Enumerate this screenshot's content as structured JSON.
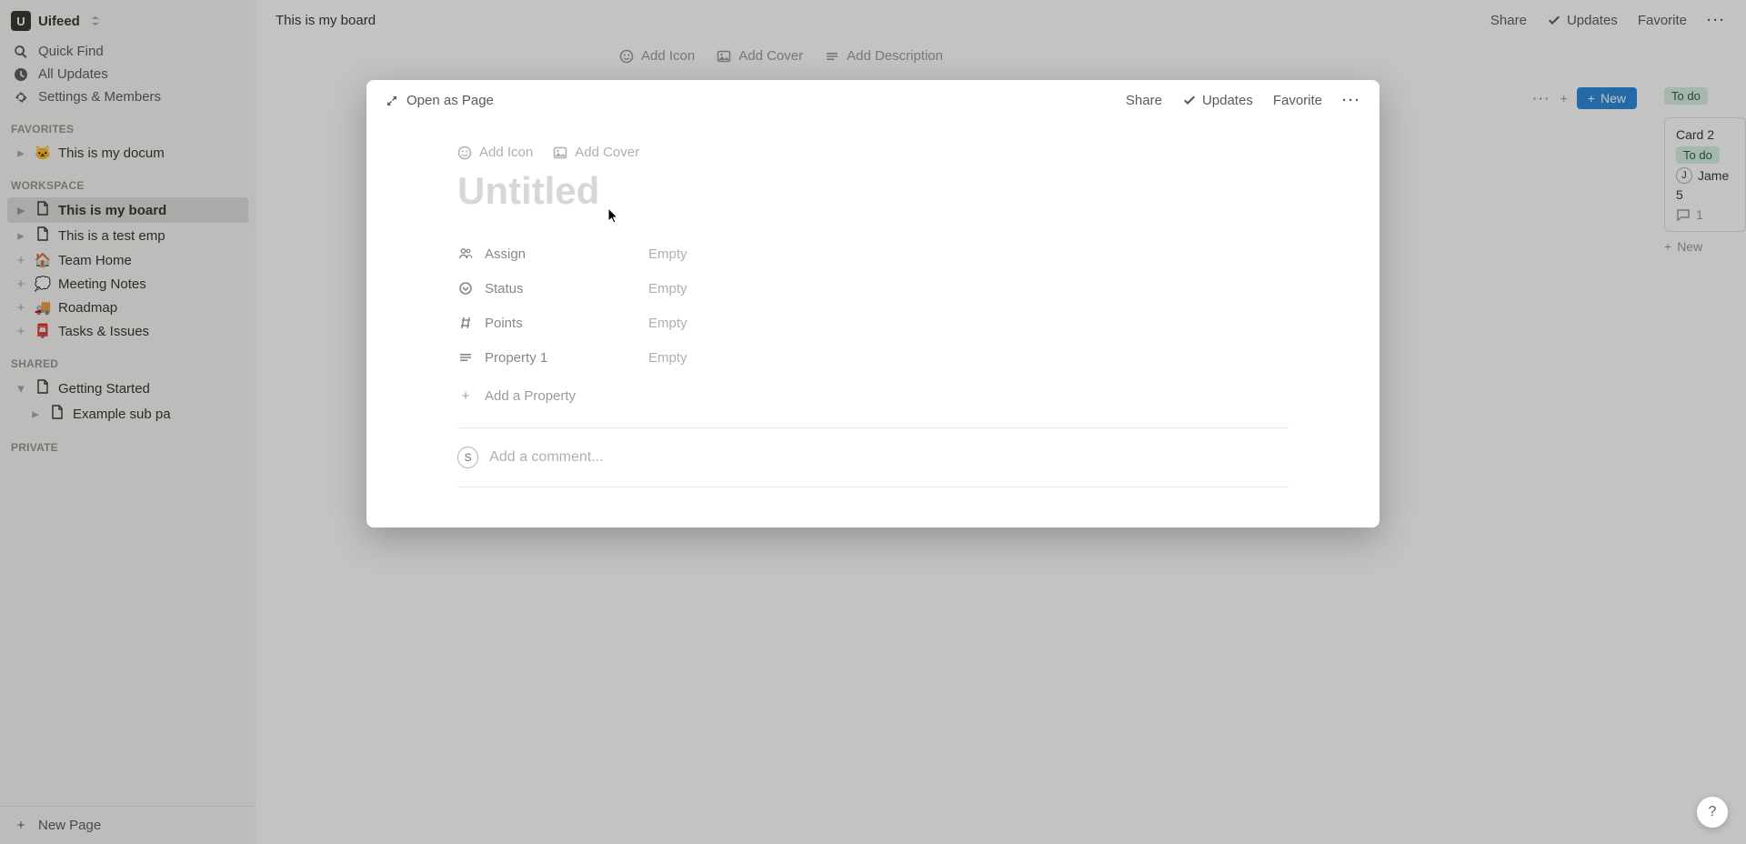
{
  "workspace": {
    "initial": "U",
    "name": "Uifeed"
  },
  "nav": {
    "quick_find": "Quick Find",
    "all_updates": "All Updates",
    "settings": "Settings & Members"
  },
  "sections": {
    "favorites": "FAVORITES",
    "workspace": "WORKSPACE",
    "shared": "SHARED",
    "private": "PRIVATE"
  },
  "favorites": [
    {
      "emoji": "🐱",
      "label": "This is my docum"
    }
  ],
  "workspace_pages": [
    {
      "icon": "page",
      "label": "This is my board",
      "active": true,
      "expander": "▸"
    },
    {
      "icon": "page",
      "label": "This is a test emp",
      "expander": "▸"
    },
    {
      "emoji": "🏠",
      "label": "Team Home",
      "expander": "+"
    },
    {
      "emoji": "💭",
      "label": "Meeting Notes",
      "expander": "+"
    },
    {
      "emoji": "🚚",
      "label": "Roadmap",
      "expander": "+"
    },
    {
      "emoji": "📮",
      "label": "Tasks & Issues",
      "expander": "+"
    }
  ],
  "shared_pages": [
    {
      "icon": "page",
      "label": "Getting Started",
      "expander": "▾"
    },
    {
      "icon": "page",
      "label": "Example sub pa",
      "sub": true,
      "expander": "▸"
    }
  ],
  "new_page": "New Page",
  "topbar": {
    "breadcrumb": "This is my board",
    "share": "Share",
    "updates": "Updates",
    "favorite": "Favorite"
  },
  "page_toolbar": {
    "add_icon": "Add Icon",
    "add_cover": "Add Cover",
    "add_desc": "Add Description"
  },
  "board": {
    "new_btn": "New",
    "col2_status": "To do",
    "card2": {
      "title": "Card 2",
      "status": "To do",
      "assignee_initial": "J",
      "assignee": "Jame",
      "points": "5",
      "comments": "1"
    },
    "new_card": "New"
  },
  "modal": {
    "open_as_page": "Open as Page",
    "share": "Share",
    "updates": "Updates",
    "favorite": "Favorite",
    "add_icon": "Add Icon",
    "add_cover": "Add Cover",
    "title_placeholder": "Untitled",
    "properties": [
      {
        "icon": "person",
        "name": "Assign",
        "value": "Empty"
      },
      {
        "icon": "tag",
        "name": "Status",
        "value": "Empty"
      },
      {
        "icon": "hash",
        "name": "Points",
        "value": "Empty"
      },
      {
        "icon": "text",
        "name": "Property 1",
        "value": "Empty"
      }
    ],
    "add_property": "Add a Property",
    "comment_placeholder": "Add a comment...",
    "comment_avatar": "S"
  },
  "help": "?"
}
